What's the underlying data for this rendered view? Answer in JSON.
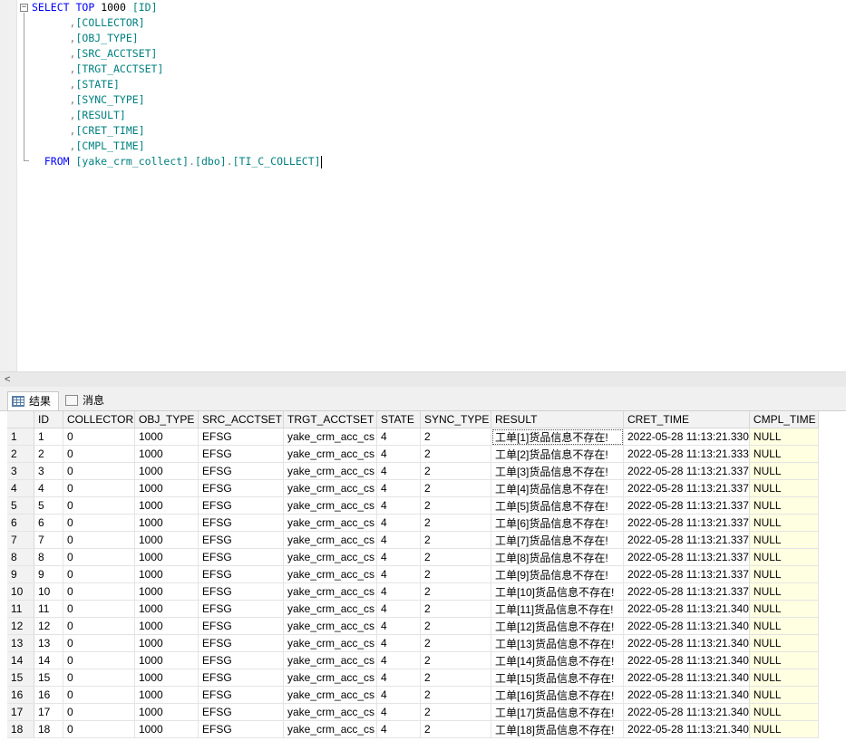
{
  "editor": {
    "collapse_symbol": "−",
    "lines": [
      [
        {
          "t": "SELECT",
          "c": "kw"
        },
        {
          "t": " ",
          "c": "tx"
        },
        {
          "t": "TOP",
          "c": "kw"
        },
        {
          "t": " 1000 ",
          "c": "tx"
        },
        {
          "t": "[ID]",
          "c": "id"
        }
      ],
      [
        {
          "t": "      ,",
          "c": "pn"
        },
        {
          "t": "[COLLECTOR]",
          "c": "id"
        }
      ],
      [
        {
          "t": "      ,",
          "c": "pn"
        },
        {
          "t": "[OBJ_TYPE]",
          "c": "id"
        }
      ],
      [
        {
          "t": "      ,",
          "c": "pn"
        },
        {
          "t": "[SRC_ACCTSET]",
          "c": "id"
        }
      ],
      [
        {
          "t": "      ,",
          "c": "pn"
        },
        {
          "t": "[TRGT_ACCTSET]",
          "c": "id"
        }
      ],
      [
        {
          "t": "      ,",
          "c": "pn"
        },
        {
          "t": "[STATE]",
          "c": "id"
        }
      ],
      [
        {
          "t": "      ,",
          "c": "pn"
        },
        {
          "t": "[SYNC_TYPE]",
          "c": "id"
        }
      ],
      [
        {
          "t": "      ,",
          "c": "pn"
        },
        {
          "t": "[RESULT]",
          "c": "id"
        }
      ],
      [
        {
          "t": "      ,",
          "c": "pn"
        },
        {
          "t": "[CRET_TIME]",
          "c": "id"
        }
      ],
      [
        {
          "t": "      ,",
          "c": "pn"
        },
        {
          "t": "[CMPL_TIME]",
          "c": "id"
        }
      ],
      [
        {
          "t": "  FROM",
          "c": "kw"
        },
        {
          "t": " ",
          "c": "tx"
        },
        {
          "t": "[yake_crm_collect]",
          "c": "id"
        },
        {
          "t": ".",
          "c": "pn"
        },
        {
          "t": "[dbo]",
          "c": "id"
        },
        {
          "t": ".",
          "c": "pn"
        },
        {
          "t": "[TI_C_COLLECT]",
          "c": "id"
        }
      ]
    ]
  },
  "scrollbar": {
    "left_arrow": "<"
  },
  "tabs": {
    "results": "结果",
    "messages": "消息"
  },
  "grid": {
    "columns": [
      "",
      "ID",
      "COLLECTOR",
      "OBJ_TYPE",
      "SRC_ACCTSET",
      "TRGT_ACCTSET",
      "STATE",
      "SYNC_TYPE",
      "RESULT",
      "CRET_TIME",
      "CMPL_TIME"
    ],
    "rows": [
      [
        "1",
        "1",
        "0",
        "1000",
        "EFSG",
        "yake_crm_acc_cs",
        "4",
        "2",
        "工单[1]货品信息不存在!",
        "2022-05-28 11:13:21.330",
        "NULL"
      ],
      [
        "2",
        "2",
        "0",
        "1000",
        "EFSG",
        "yake_crm_acc_cs",
        "4",
        "2",
        "工单[2]货品信息不存在!",
        "2022-05-28 11:13:21.333",
        "NULL"
      ],
      [
        "3",
        "3",
        "0",
        "1000",
        "EFSG",
        "yake_crm_acc_cs",
        "4",
        "2",
        "工单[3]货品信息不存在!",
        "2022-05-28 11:13:21.337",
        "NULL"
      ],
      [
        "4",
        "4",
        "0",
        "1000",
        "EFSG",
        "yake_crm_acc_cs",
        "4",
        "2",
        "工单[4]货品信息不存在!",
        "2022-05-28 11:13:21.337",
        "NULL"
      ],
      [
        "5",
        "5",
        "0",
        "1000",
        "EFSG",
        "yake_crm_acc_cs",
        "4",
        "2",
        "工单[5]货品信息不存在!",
        "2022-05-28 11:13:21.337",
        "NULL"
      ],
      [
        "6",
        "6",
        "0",
        "1000",
        "EFSG",
        "yake_crm_acc_cs",
        "4",
        "2",
        "工单[6]货品信息不存在!",
        "2022-05-28 11:13:21.337",
        "NULL"
      ],
      [
        "7",
        "7",
        "0",
        "1000",
        "EFSG",
        "yake_crm_acc_cs",
        "4",
        "2",
        "工单[7]货品信息不存在!",
        "2022-05-28 11:13:21.337",
        "NULL"
      ],
      [
        "8",
        "8",
        "0",
        "1000",
        "EFSG",
        "yake_crm_acc_cs",
        "4",
        "2",
        "工单[8]货品信息不存在!",
        "2022-05-28 11:13:21.337",
        "NULL"
      ],
      [
        "9",
        "9",
        "0",
        "1000",
        "EFSG",
        "yake_crm_acc_cs",
        "4",
        "2",
        "工单[9]货品信息不存在!",
        "2022-05-28 11:13:21.337",
        "NULL"
      ],
      [
        "10",
        "10",
        "0",
        "1000",
        "EFSG",
        "yake_crm_acc_cs",
        "4",
        "2",
        "工单[10]货品信息不存在!",
        "2022-05-28 11:13:21.337",
        "NULL"
      ],
      [
        "11",
        "11",
        "0",
        "1000",
        "EFSG",
        "yake_crm_acc_cs",
        "4",
        "2",
        "工单[11]货品信息不存在!",
        "2022-05-28 11:13:21.340",
        "NULL"
      ],
      [
        "12",
        "12",
        "0",
        "1000",
        "EFSG",
        "yake_crm_acc_cs",
        "4",
        "2",
        "工单[12]货品信息不存在!",
        "2022-05-28 11:13:21.340",
        "NULL"
      ],
      [
        "13",
        "13",
        "0",
        "1000",
        "EFSG",
        "yake_crm_acc_cs",
        "4",
        "2",
        "工单[13]货品信息不存在!",
        "2022-05-28 11:13:21.340",
        "NULL"
      ],
      [
        "14",
        "14",
        "0",
        "1000",
        "EFSG",
        "yake_crm_acc_cs",
        "4",
        "2",
        "工单[14]货品信息不存在!",
        "2022-05-28 11:13:21.340",
        "NULL"
      ],
      [
        "15",
        "15",
        "0",
        "1000",
        "EFSG",
        "yake_crm_acc_cs",
        "4",
        "2",
        "工单[15]货品信息不存在!",
        "2022-05-28 11:13:21.340",
        "NULL"
      ],
      [
        "16",
        "16",
        "0",
        "1000",
        "EFSG",
        "yake_crm_acc_cs",
        "4",
        "2",
        "工单[16]货品信息不存在!",
        "2022-05-28 11:13:21.340",
        "NULL"
      ],
      [
        "17",
        "17",
        "0",
        "1000",
        "EFSG",
        "yake_crm_acc_cs",
        "4",
        "2",
        "工单[17]货品信息不存在!",
        "2022-05-28 11:13:21.340",
        "NULL"
      ],
      [
        "18",
        "18",
        "0",
        "1000",
        "EFSG",
        "yake_crm_acc_cs",
        "4",
        "2",
        "工单[18]货品信息不存在!",
        "2022-05-28 11:13:21.340",
        "NULL"
      ]
    ]
  }
}
